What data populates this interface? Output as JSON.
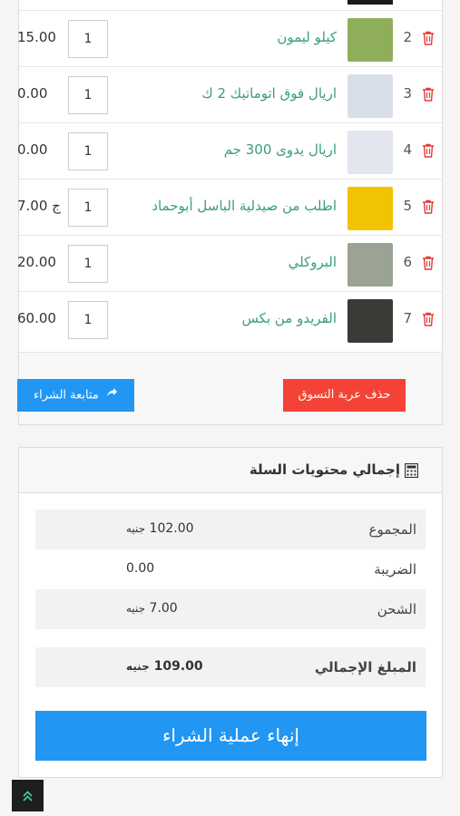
{
  "cart": {
    "items": [
      {
        "index": "2",
        "name": "كيلو ليمون",
        "qty": "1",
        "price": "15.00",
        "thumb_color": "#8fae5a"
      },
      {
        "index": "3",
        "name": "اريال فوق اتوماتيك 2 ك",
        "qty": "1",
        "price": "0.00",
        "thumb_color": "#d9dfe8"
      },
      {
        "index": "4",
        "name": "اريال يدوى 300 جم",
        "qty": "1",
        "price": "0.00",
        "thumb_color": "#e3e6ee"
      },
      {
        "index": "5",
        "name": "اطلب من صيدلية الباسل أبوحماد",
        "qty": "1",
        "price": "7.00 ج",
        "thumb_color": "#f2c300"
      },
      {
        "index": "6",
        "name": "البروكلي",
        "qty": "1",
        "price": "20.00",
        "thumb_color": "#9aa394"
      },
      {
        "index": "7",
        "name": "الفريدو من بكس",
        "qty": "1",
        "price": "60.00",
        "thumb_color": "#3a3a36"
      }
    ],
    "continue_label": "متابعة الشراء",
    "clear_label": "حذف عربة التسوق"
  },
  "summary": {
    "title": "إجمالي محتويات السلة",
    "subtotal_label": "المجموع",
    "subtotal_value": "102.00",
    "tax_label": "الضريبة",
    "tax_value": "0.00",
    "shipping_label": "الشحن",
    "shipping_value": "7.00",
    "total_label": "المبلغ الإجمالي",
    "total_value": "109.00",
    "currency": "جنيه",
    "checkout_label": "إنهاء عملية الشراء"
  },
  "colors": {
    "primary": "#2196f3",
    "danger": "#f44336",
    "product_link": "#3a9e7a"
  },
  "icons": [
    "trash-icon",
    "share-icon",
    "calculator-icon",
    "chevron-up-icon"
  ]
}
